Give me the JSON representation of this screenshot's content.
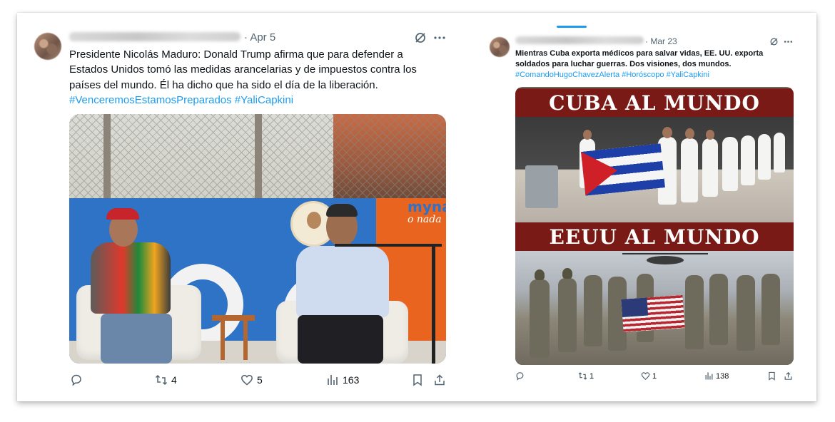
{
  "post1": {
    "date": "· Apr 5",
    "text": "Presidente Nicolás Maduro: Donald Trump afirma que para defender a Estados Unidos tomó las medidas arancelarias y de impuestos contra los países del mundo. Él ha dicho que ha sido el día de la liberación.",
    "hashtags": "#VenceremosEstamosPreparados #YaliCapkini",
    "media_text": {
      "brand": "myna",
      "tagline": "o nada"
    },
    "stats": {
      "retweets": "4",
      "likes": "5",
      "views": "163"
    }
  },
  "post2": {
    "date": "· Mar 23",
    "text": "Mientras Cuba exporta médicos para salvar vidas, EE. UU. exporta soldados para luchar guerras. Dos visiones, dos mundos.",
    "hashtags": "#ComandoHugoChavezAlerta #Horóscopo #YaliCapkini",
    "media_text": {
      "top_banner": "CUBA AL MUNDO",
      "bottom_banner": "EEUU AL MUNDO"
    },
    "stats": {
      "retweets": "1",
      "likes": "1",
      "views": "138"
    }
  },
  "icons": [
    "grok-icon",
    "more-icon",
    "reply-icon",
    "retweet-icon",
    "like-icon",
    "views-icon",
    "bookmark-icon",
    "share-icon"
  ],
  "colors": {
    "link": "#1d9bf0",
    "muted": "#536471",
    "banner": "#7a1a16"
  }
}
